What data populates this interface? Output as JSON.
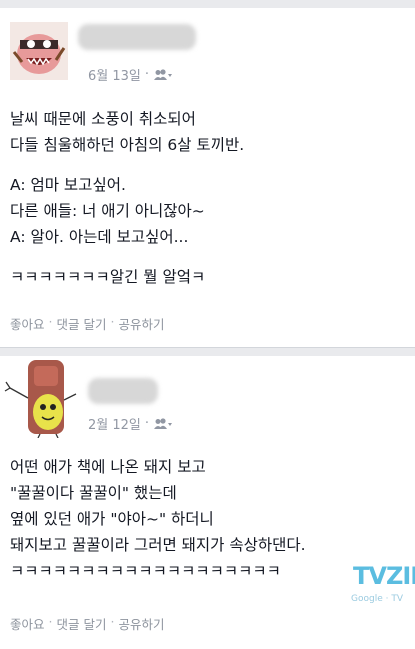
{
  "posts": [
    {
      "date": "6월 13일",
      "meta_separator": "·",
      "privacy_icon": "friends-icon",
      "lines": [
        "날씨 때문에 소풍이 취소되어",
        "다들 침울해하던 아침의 6살 토끼반.",
        "",
        "A: 엄마 보고싶어.",
        "다른 애들: 너 애기 아니잖아~",
        "A: 알아. 아는데 보고싶어...",
        "",
        "ㅋㅋㅋㅋㅋㅋㅋ알긴 뭘 알엌ㅋ"
      ],
      "actions": {
        "like": "좋아요",
        "comment": "댓글 달기",
        "share": "공유하기",
        "separator": "·"
      }
    },
    {
      "date": "2월 12일",
      "meta_separator": "·",
      "privacy_icon": "friends-icon",
      "lines": [
        "어떤 애가 책에 나온 돼지 보고",
        "\"꿀꿀이다 꿀꿀이\" 했는데",
        "옆에 있던 애가 \"야아~\" 하더니",
        "돼지보고 꿀꿀이라 그러면 돼지가 속상하댄다.",
        "ㅋㅋㅋㅋㅋㅋㅋㅋㅋㅋㅋㅋㅋㅋㅋㅋㅋㅋㅋ"
      ],
      "actions": {
        "like": "좋아요",
        "comment": "댓글 달기",
        "share": "공유하기",
        "separator": "·"
      }
    }
  ],
  "watermark": {
    "main": "TVZIL",
    "sub": "Google · TV",
    "color": "#5bbde0"
  },
  "colors": {
    "background": "#e9eaed",
    "card": "#ffffff",
    "meta": "#9197a3",
    "text": "#141823"
  }
}
